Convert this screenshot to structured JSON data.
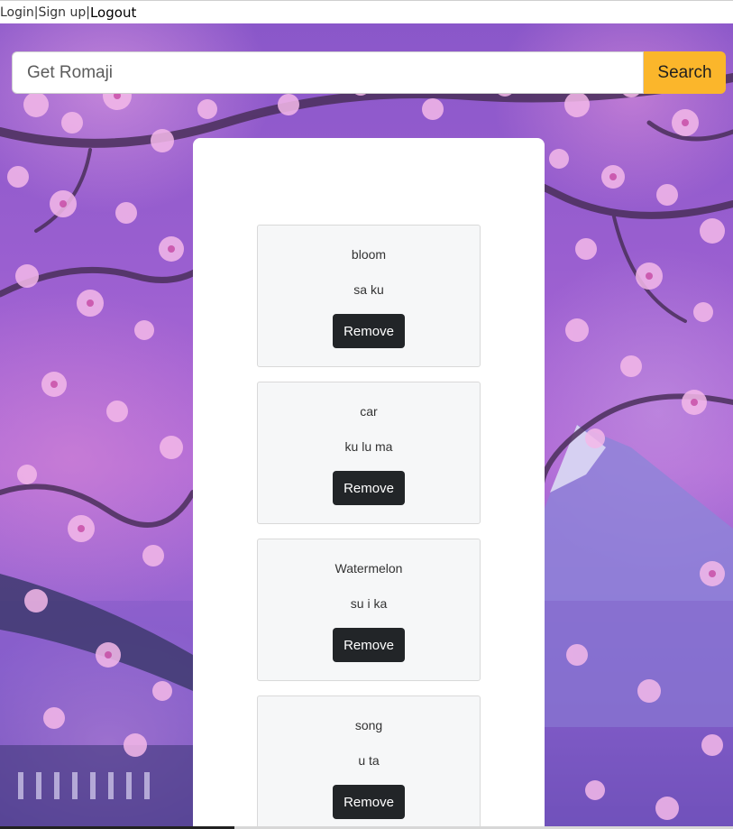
{
  "nav": {
    "login": "Login",
    "sep1": "|",
    "signup": "Sign up",
    "sep2": "|",
    "logout": "Logout"
  },
  "search": {
    "placeholder": "Get Romaji",
    "button_label": "Search"
  },
  "cards": [
    {
      "word": "bloom",
      "romaji": "sa ku",
      "button_label": "Remove"
    },
    {
      "word": "car",
      "romaji": "ku lu ma",
      "button_label": "Remove"
    },
    {
      "word": "Watermelon",
      "romaji": "su i ka",
      "button_label": "Remove"
    },
    {
      "word": "song",
      "romaji": "u ta",
      "button_label": "Remove"
    }
  ],
  "colors": {
    "search_button": "#fbb62b",
    "remove_button": "#222528",
    "card_background": "#f6f7f8"
  }
}
